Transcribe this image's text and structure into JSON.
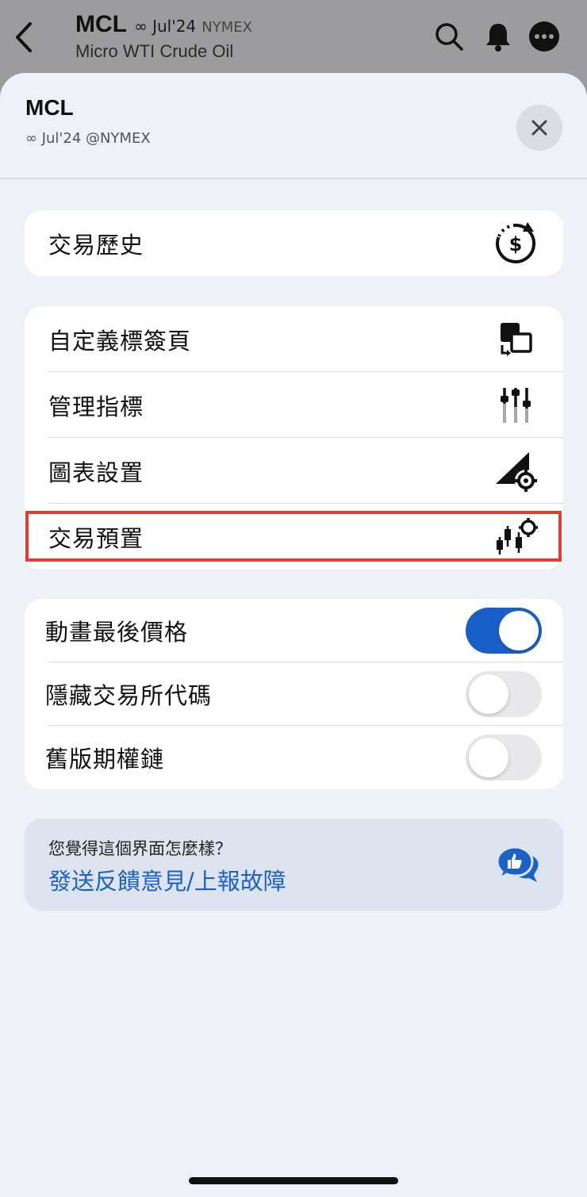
{
  "background": {
    "symbol": "MCL",
    "contract": "∞ Jul'24",
    "exchange": "NYMEX",
    "name": "Micro WTI Crude Oil"
  },
  "sheet": {
    "title": "MCL",
    "subtitle": "∞ Jul'24 @NYMEX"
  },
  "group1": [
    {
      "label": "交易歷史",
      "icon": "trade-history-icon"
    }
  ],
  "group2": [
    {
      "label": "自定義標簽頁",
      "icon": "custom-tabs-icon"
    },
    {
      "label": "管理指標",
      "icon": "indicators-sliders-icon"
    },
    {
      "label": "圖表設置",
      "icon": "chart-settings-icon"
    },
    {
      "label": "交易預置",
      "icon": "trade-presets-icon"
    }
  ],
  "group3": [
    {
      "label": "動畫最後價格",
      "on": true
    },
    {
      "label": "隱藏交易所代碼",
      "on": false
    },
    {
      "label": "舊版期權鏈",
      "on": false
    }
  ],
  "feedback": {
    "question": "您覺得這個界面怎麼樣？",
    "link": "發送反饋意見/上報故障"
  },
  "colors": {
    "accent": "#1a5fc8",
    "highlight": "#e43b33",
    "sheet_bg": "#eef1f7"
  }
}
